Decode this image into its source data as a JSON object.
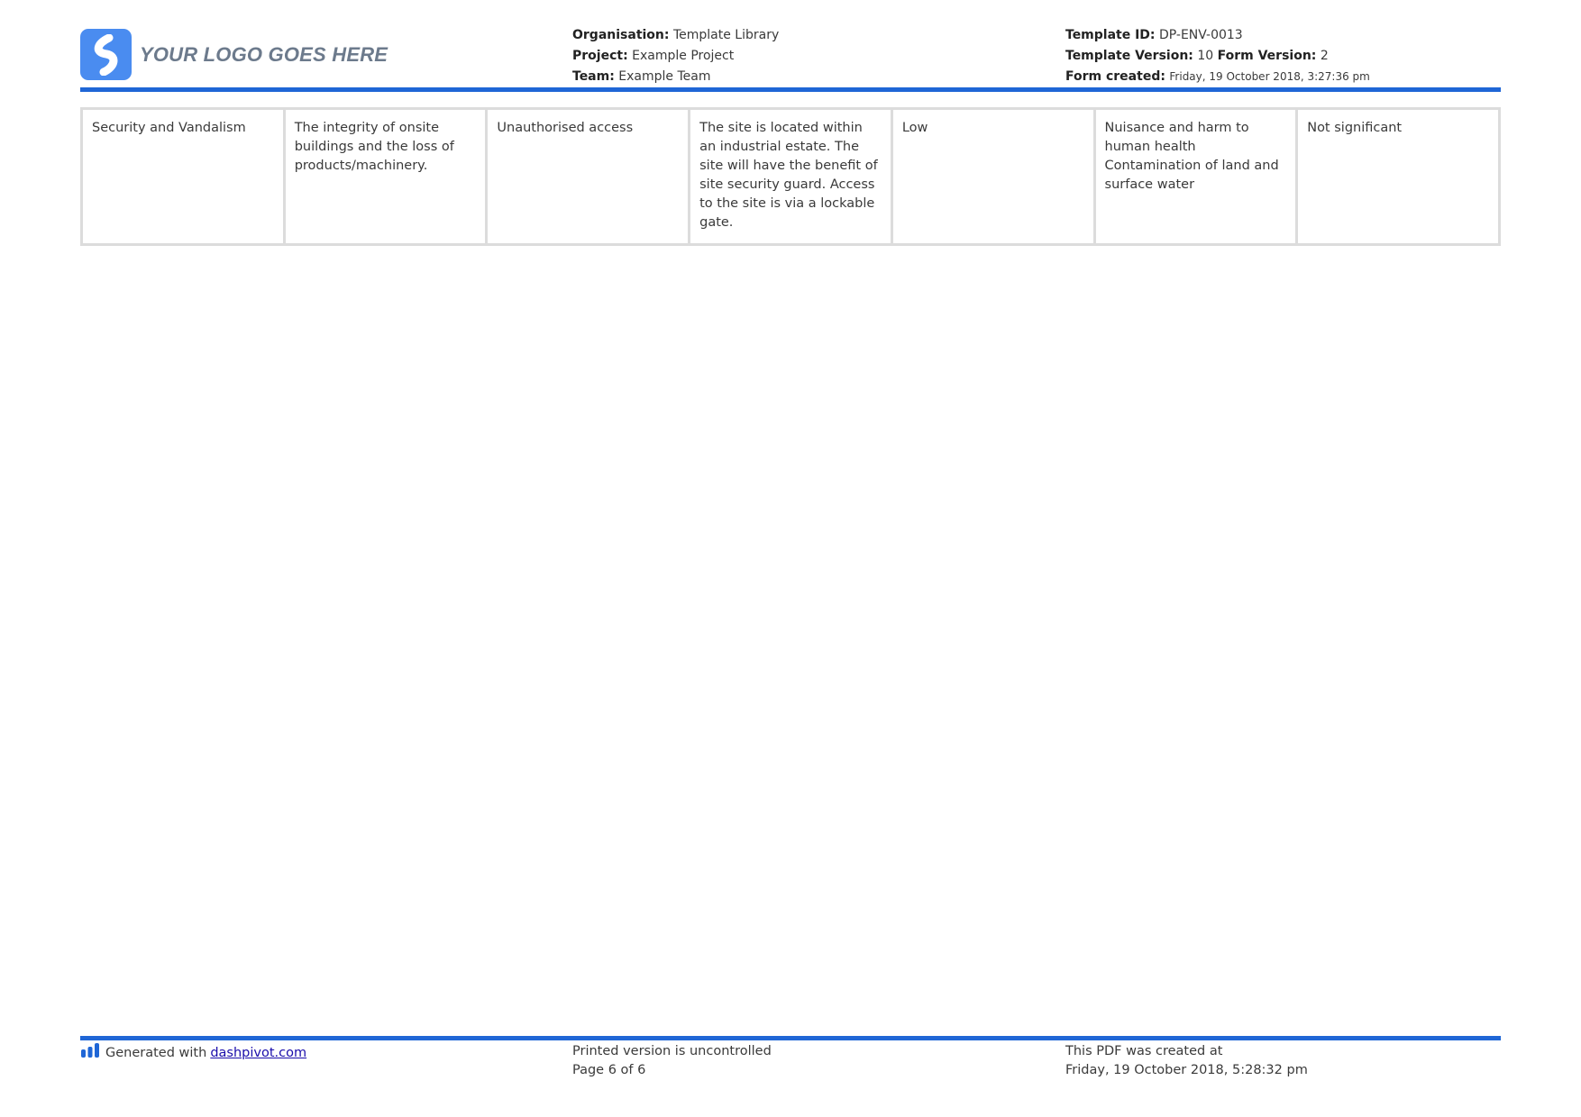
{
  "header": {
    "logo_text": "YOUR LOGO GOES HERE",
    "organisation_label": "Organisation:",
    "organisation_value": "Template Library",
    "project_label": "Project:",
    "project_value": "Example Project",
    "team_label": "Team:",
    "team_value": "Example Team",
    "template_id_label": "Template ID:",
    "template_id_value": "DP-ENV-0013",
    "template_version_label": "Template Version:",
    "template_version_value": "10",
    "form_version_label": "Form Version:",
    "form_version_value": "2",
    "form_created_label": "Form created:",
    "form_created_value": "Friday, 19 October 2018, 3:27:36 pm"
  },
  "table": {
    "rows": [
      [
        "Security and Vandalism",
        "The integrity of onsite buildings and the loss of products/machinery.",
        "Unauthorised access",
        "The site is located within an industrial estate. The site will have the benefit of site security guard. Access to the site is via a lockable gate.",
        "Low",
        "Nuisance and harm to human health Contamination of land and surface water",
        "Not significant"
      ]
    ]
  },
  "footer": {
    "generated_text": "Generated with",
    "generated_link": "dashpivot.com",
    "uncontrolled_text": "Printed version is uncontrolled",
    "page_text": "Page 6 of 6",
    "pdf_created_text": "This PDF was created at",
    "pdf_created_value": "Friday, 19 October 2018, 5:28:32 pm"
  },
  "colors": {
    "accent": "#1f66d6",
    "logo_mark": "#4a8cf0",
    "logo_text": "#6c7a8c",
    "cell_border": "#dcdcdc",
    "link": "#1a0dab"
  },
  "icons": {
    "logo": "dashpivot-logo-icon",
    "footer": "bar-chart-icon"
  }
}
